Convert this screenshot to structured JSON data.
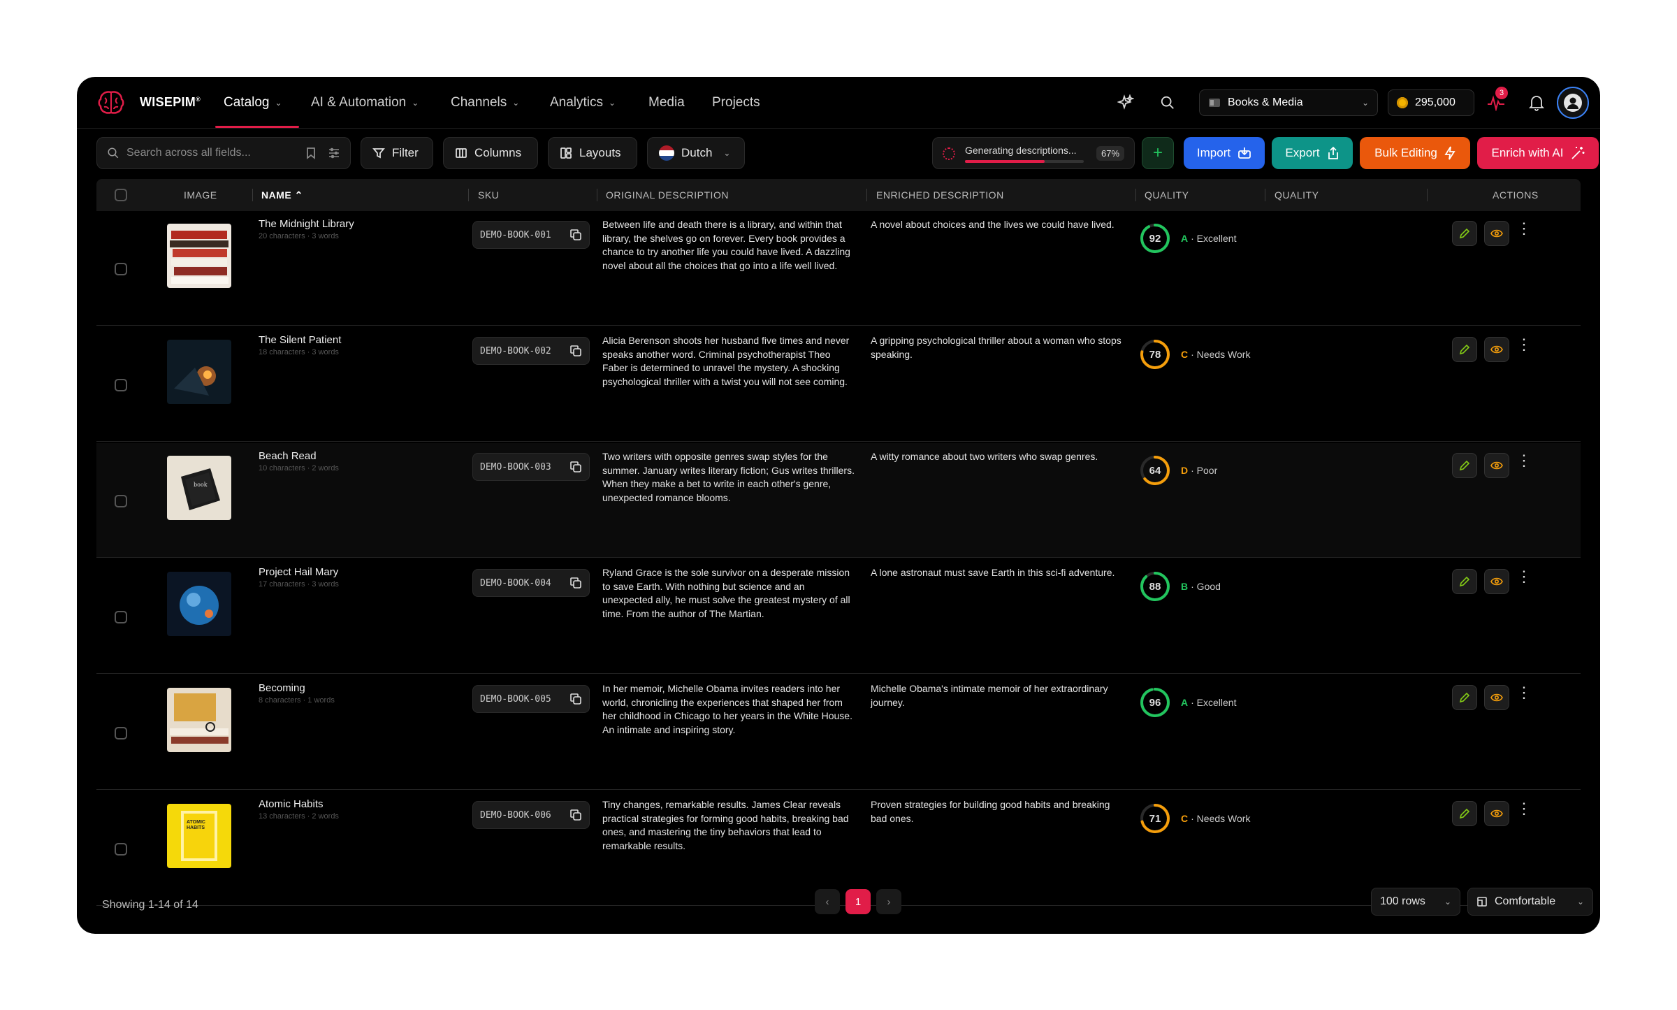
{
  "nav": {
    "brand": "WISEPIM",
    "brand_mark": "®",
    "items": [
      {
        "label": "Catalog",
        "dropdown": true,
        "active": true
      },
      {
        "label": "AI & Automation",
        "dropdown": true
      },
      {
        "label": "Channels",
        "dropdown": true
      },
      {
        "label": "Analytics",
        "dropdown": true
      },
      {
        "label": "Media",
        "dropdown": false
      },
      {
        "label": "Projects",
        "dropdown": false
      }
    ],
    "store_selector": "Books & Media",
    "credits": "295,000",
    "activity_badge": "3",
    "accent_color": "#e11d48"
  },
  "toolbar": {
    "search_placeholder": "Search across all fields...",
    "filter_label": "Filter",
    "columns_label": "Columns",
    "layouts_label": "Layouts",
    "language_label": "Dutch",
    "generating_text": "Generating descriptions...",
    "generating_percent": "67%",
    "generating_progress": 0.67,
    "import_label": "Import",
    "export_label": "Export",
    "bulk_label": "Bulk Editing",
    "enrich_label": "Enrich with AI",
    "colors": {
      "import": "#2563eb",
      "export": "#0d9488",
      "bulk": "#ea580c",
      "enrich": "#e11d48"
    }
  },
  "table": {
    "headers": {
      "image": "IMAGE",
      "name": "NAME",
      "sku": "SKU",
      "original": "ORIGINAL DESCRIPTION",
      "enriched": "ENRICHED DESCRIPTION",
      "quality1": "QUALITY",
      "quality2": "QUALITY",
      "actions": "ACTIONS"
    },
    "rows": [
      {
        "name": "The Midnight Library",
        "meta": "20 characters · 3 words",
        "sku": "DEMO-BOOK-001",
        "original": "Between life and death there is a library, and within that library, the shelves go on forever. Every book provides a chance to try another life you could have lived. A dazzling novel about all the choices that go into a life well lived.",
        "enriched": "A novel about choices and the lives we could have lived.",
        "score": "92",
        "score_value": 92,
        "grade": "A",
        "grade_label": "· Excellent",
        "color": "#22c55e"
      },
      {
        "name": "The Silent Patient",
        "meta": "18 characters · 3 words",
        "sku": "DEMO-BOOK-002",
        "original": "Alicia Berenson shoots her husband five times and never speaks another word. Criminal psychotherapist Theo Faber is determined to unravel the mystery. A shocking psychological thriller with a twist you will not see coming.",
        "enriched": "A gripping psychological thriller about a woman who stops speaking.",
        "score": "78",
        "score_value": 78,
        "grade": "C",
        "grade_label": "· Needs Work",
        "color": "#f59e0b"
      },
      {
        "name": "Beach Read",
        "meta": "10 characters · 2 words",
        "sku": "DEMO-BOOK-003",
        "original": "Two writers with opposite genres swap styles for the summer. January writes literary fiction; Gus writes thrillers. When they make a bet to write in each other's genre, unexpected romance blooms.",
        "enriched": "A witty romance about two writers who swap genres.",
        "score": "64",
        "score_value": 64,
        "grade": "D",
        "grade_label": "· Poor",
        "color": "#f59e0b"
      },
      {
        "name": "Project Hail Mary",
        "meta": "17 characters · 3 words",
        "sku": "DEMO-BOOK-004",
        "original": "Ryland Grace is the sole survivor on a desperate mission to save Earth. With nothing but science and an unexpected ally, he must solve the greatest mystery of all time. From the author of The Martian.",
        "enriched": "A lone astronaut must save Earth in this sci-fi adventure.",
        "score": "88",
        "score_value": 88,
        "grade": "B",
        "grade_label": "· Good",
        "color": "#22c55e"
      },
      {
        "name": "Becoming",
        "meta": "8 characters · 1 words",
        "sku": "DEMO-BOOK-005",
        "original": "In her memoir, Michelle Obama invites readers into her world, chronicling the experiences that shaped her from her childhood in Chicago to her years in the White House. An intimate and inspiring story.",
        "enriched": "Michelle Obama's intimate memoir of her extraordinary journey.",
        "score": "96",
        "score_value": 96,
        "grade": "A",
        "grade_label": "· Excellent",
        "color": "#22c55e"
      },
      {
        "name": "Atomic Habits",
        "meta": "13 characters · 2 words",
        "sku": "DEMO-BOOK-006",
        "original": "Tiny changes, remarkable results. James Clear reveals practical strategies for forming good habits, breaking bad ones, and mastering the tiny behaviors that lead to remarkable results.",
        "enriched": "Proven strategies for building good habits and breaking bad ones.",
        "score": "71",
        "score_value": 71,
        "grade": "C",
        "grade_label": "· Needs Work",
        "color": "#f59e0b"
      }
    ]
  },
  "footer": {
    "showing": "Showing 1-14 of 14",
    "page": "1",
    "prev": "‹",
    "next": "›",
    "rows_label": "100 rows",
    "density_label": "Comfortable"
  }
}
